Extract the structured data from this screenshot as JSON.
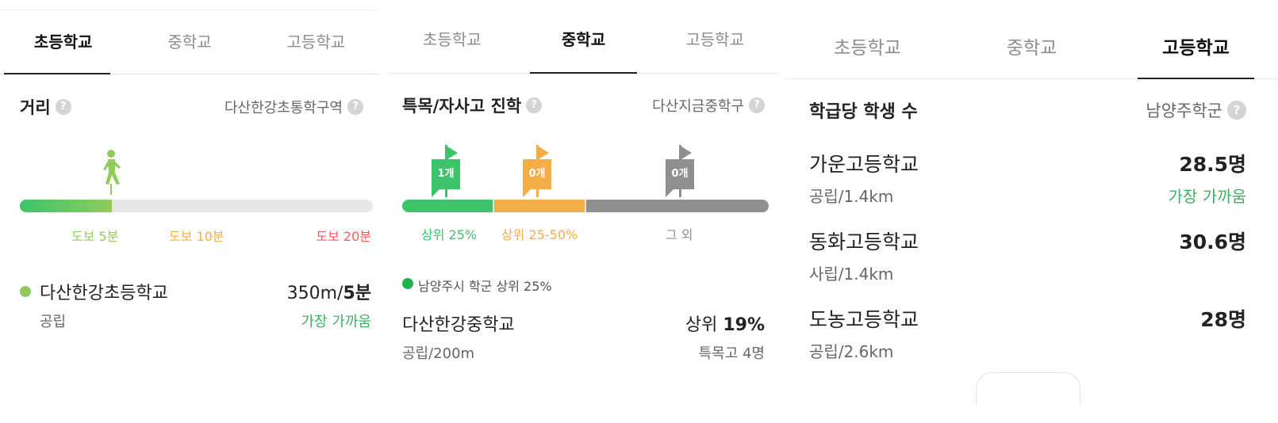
{
  "colors": {
    "green": "#3cc36b",
    "light_green": "#8fcc5c",
    "orange": "#f5ad47",
    "gray": "#8f8f8f",
    "red": "#f05a5a",
    "track": "#e6e6e6",
    "nearest_green": "#3db15f"
  },
  "panel1": {
    "tabs": [
      "초등학교",
      "중학교",
      "고등학교"
    ],
    "active_tab": "초등학교",
    "title": "거리",
    "region": "다산한강초통학구역",
    "walk_icon": "walking-person-icon",
    "walk_progress_pct": 26,
    "walk_labels": [
      "도보 5분",
      "도보 10분",
      "도보 20분"
    ],
    "school": {
      "name": "다산한강초등학교",
      "distance": "350m/",
      "time": "5분",
      "type": "공립",
      "note": "가장 가까움"
    }
  },
  "panel2": {
    "tabs": [
      "초등학교",
      "중학교",
      "고등학교"
    ],
    "active_tab": "중학교",
    "title": "특목/자사고 진학",
    "region": "다산지금중학구",
    "flags": [
      {
        "count": "1개",
        "color": "#3cc36b"
      },
      {
        "count": "0개",
        "color": "#f5ad47"
      },
      {
        "count": "0개",
        "color": "#8f8f8f"
      }
    ],
    "segments": [
      "상위 25%",
      "상위 25-50%",
      "그 외"
    ],
    "legend": "남양주시 학군 상위 25%",
    "school": {
      "name": "다산한강중학교",
      "rank_prefix": "상위 ",
      "rank_value": "19%",
      "sub": "공립/200m",
      "note": "특목고 4명"
    }
  },
  "panel3": {
    "tabs": [
      "초등학교",
      "중학교",
      "고등학교"
    ],
    "active_tab": "고등학교",
    "title": "학급당 학생 수",
    "region": "남양주학군",
    "schools": [
      {
        "name": "가운고등학교",
        "sub": "공립/1.4km",
        "value": "28.5명",
        "note": "가장 가까움"
      },
      {
        "name": "동화고등학교",
        "sub": "사립/1.4km",
        "value": "30.6명",
        "note": ""
      },
      {
        "name": "도농고등학교",
        "sub": "공립/2.6km",
        "value": "28명",
        "note": ""
      }
    ]
  }
}
